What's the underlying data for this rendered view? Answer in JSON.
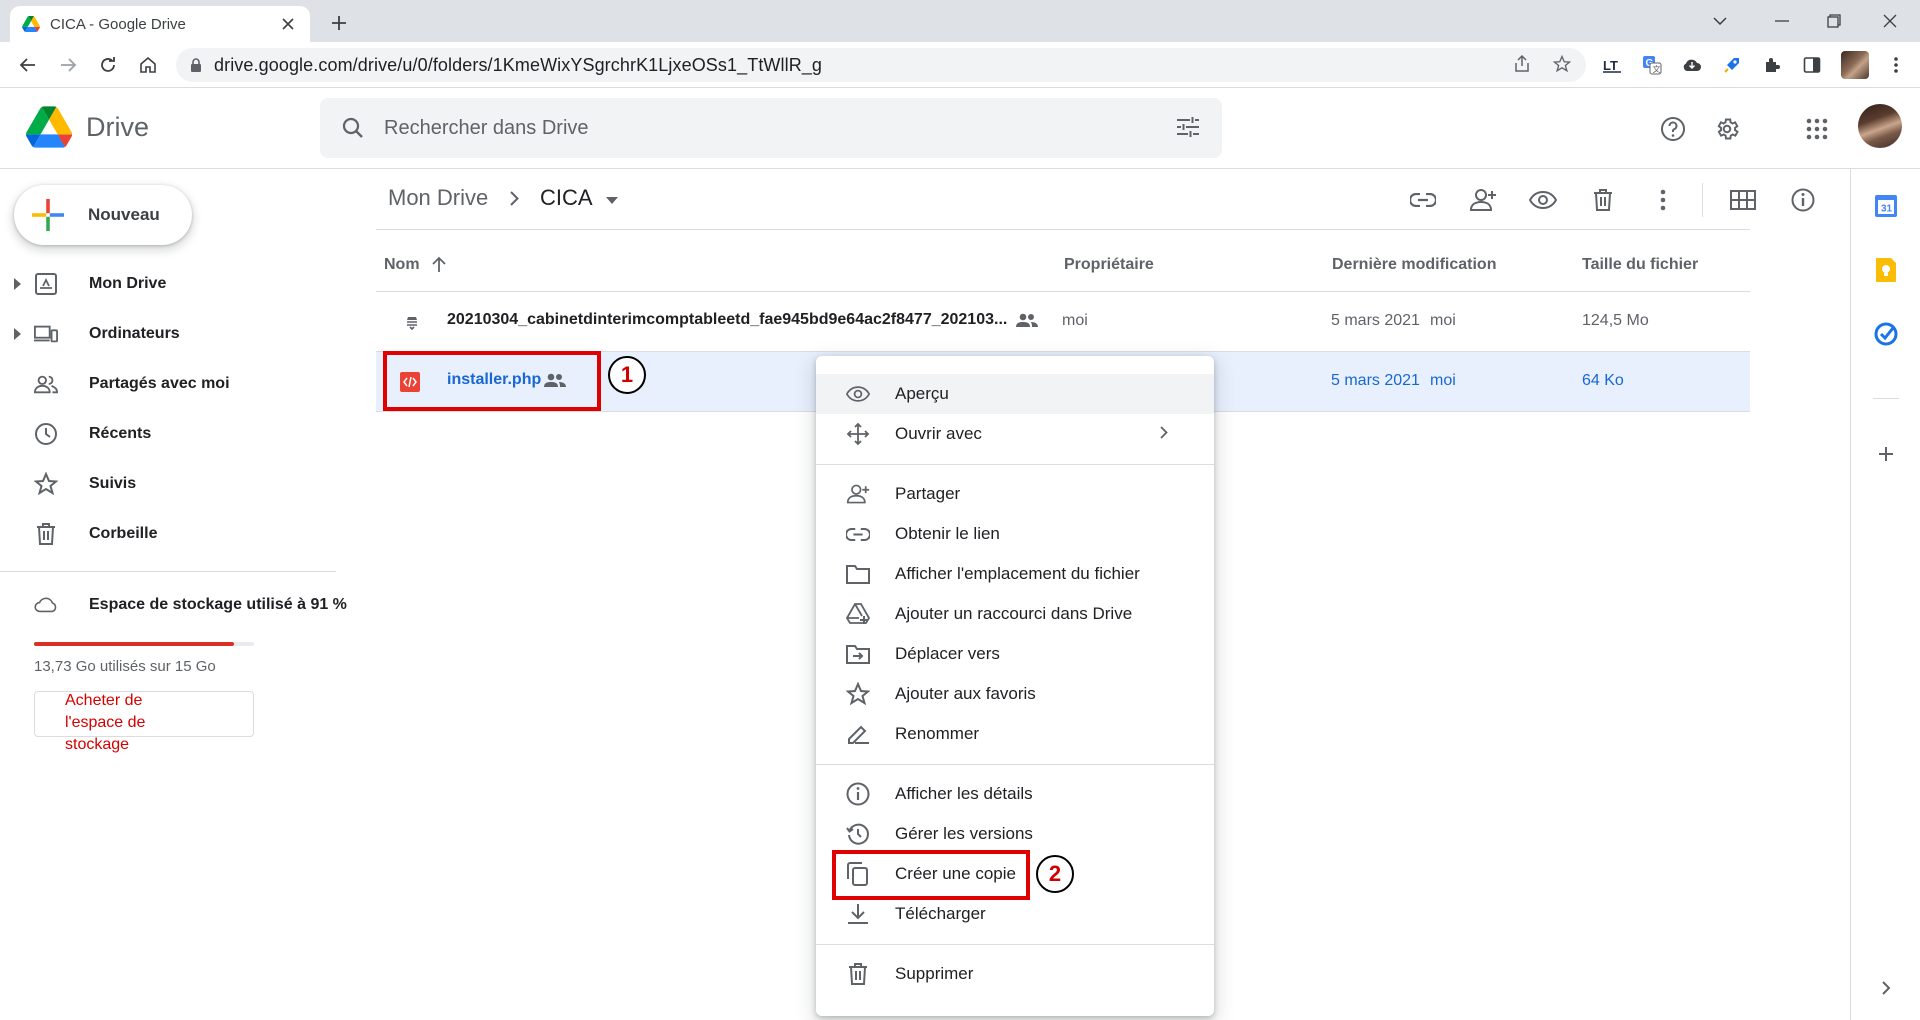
{
  "browser": {
    "tab_title": "CICA - Google Drive",
    "url": "drive.google.com/drive/u/0/folders/1KmeWixYSgrchrK1LjxeOSs1_TtWllR_g"
  },
  "header": {
    "app_name": "Drive",
    "search_placeholder": "Rechercher dans Drive"
  },
  "sidebar": {
    "new_label": "Nouveau",
    "items": [
      {
        "label": "Mon Drive",
        "icon": "my-drive-icon"
      },
      {
        "label": "Ordinateurs",
        "icon": "computers-icon"
      },
      {
        "label": "Partagés avec moi",
        "icon": "shared-icon"
      },
      {
        "label": "Récents",
        "icon": "clock-icon"
      },
      {
        "label": "Suivis",
        "icon": "star-icon"
      },
      {
        "label": "Corbeille",
        "icon": "trash-icon"
      }
    ],
    "storage_label": "Espace de stockage utilisé à 91 %",
    "storage_used": "13,73 Go utilisés sur 15 Go",
    "storage_fraction": 0.91,
    "buy_storage": "Acheter de l'espace de stockage"
  },
  "breadcrumb": {
    "root": "Mon Drive",
    "current": "CICA"
  },
  "table": {
    "headers": {
      "name": "Nom",
      "owner": "Propriétaire",
      "modified": "Dernière modification",
      "size": "Taille du fichier"
    },
    "rows": [
      {
        "name": "20210304_cabinetdinterimcomptableetd_fae945bd9e64ac2f8477_202103...",
        "owner": "moi",
        "modified_date": "5 mars 2021",
        "modified_by": "moi",
        "size": "124,5 Mo"
      },
      {
        "name": "installer.php",
        "owner": "",
        "modified_date": "5 mars 2021",
        "modified_by": "moi",
        "size": "64 Ko"
      }
    ]
  },
  "context_menu": {
    "items": [
      {
        "label": "Aperçu",
        "icon": "eye-icon"
      },
      {
        "label": "Ouvrir avec",
        "icon": "move-arrows-icon"
      },
      {
        "label": "Partager",
        "icon": "person-add-icon"
      },
      {
        "label": "Obtenir le lien",
        "icon": "link-icon"
      },
      {
        "label": "Afficher l'emplacement du fichier",
        "icon": "folder-icon"
      },
      {
        "label": "Ajouter un raccourci dans Drive",
        "icon": "drive-shortcut-icon"
      },
      {
        "label": "Déplacer vers",
        "icon": "move-to-icon"
      },
      {
        "label": "Ajouter aux favoris",
        "icon": "star-icon"
      },
      {
        "label": "Renommer",
        "icon": "pencil-icon"
      },
      {
        "label": "Afficher les détails",
        "icon": "info-icon"
      },
      {
        "label": "Gérer les versions",
        "icon": "history-icon"
      },
      {
        "label": "Créer une copie",
        "icon": "copy-icon"
      },
      {
        "label": "Télécharger",
        "icon": "download-icon"
      },
      {
        "label": "Supprimer",
        "icon": "trash-icon"
      }
    ]
  },
  "annotations": {
    "step1": "1",
    "step2": "2"
  },
  "colors": {
    "accent_blue": "#1967d2",
    "selection_bg": "#e8f0fe",
    "annotation_red": "#e00000",
    "storage_red": "#d93025"
  }
}
